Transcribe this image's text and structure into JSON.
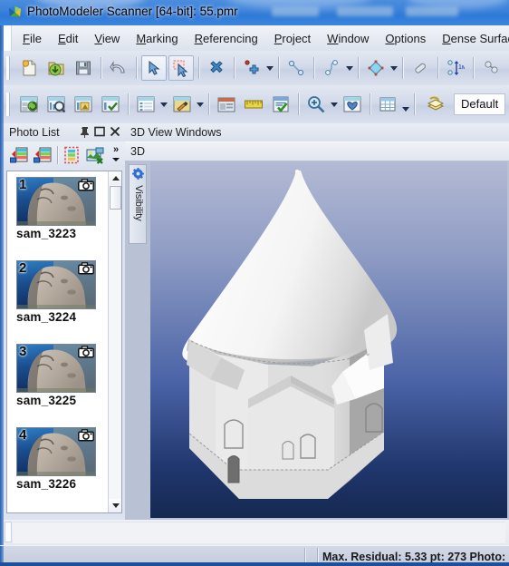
{
  "window": {
    "title": "PhotoModeler Scanner [64-bit]: 55.pmr",
    "app_icon": "photomodeler-logo-icon"
  },
  "menu": {
    "items": [
      {
        "label": "File",
        "mnemonic": "F"
      },
      {
        "label": "Edit",
        "mnemonic": "E"
      },
      {
        "label": "View",
        "mnemonic": "V"
      },
      {
        "label": "Marking",
        "mnemonic": "M"
      },
      {
        "label": "Referencing",
        "mnemonic": "R"
      },
      {
        "label": "Project",
        "mnemonic": "P"
      },
      {
        "label": "Window",
        "mnemonic": "W"
      },
      {
        "label": "Options",
        "mnemonic": "O"
      },
      {
        "label": "Dense Surface",
        "mnemonic": "D"
      }
    ]
  },
  "toolbar_row1": {
    "buttons": [
      {
        "name": "new-project-icon",
        "tip": "New Project"
      },
      {
        "name": "open-project-icon",
        "tip": "Open Project"
      },
      {
        "name": "save-project-icon",
        "tip": "Save Project"
      },
      {
        "name": "undo-icon",
        "tip": "Undo"
      },
      {
        "name": "select-pointer-icon",
        "tip": "Select",
        "state": "active"
      },
      {
        "name": "select-by-area-icon",
        "tip": "Select By Area",
        "state": "active"
      },
      {
        "name": "delete-item-icon",
        "tip": "Delete Item"
      },
      {
        "name": "mark-points-icon",
        "tip": "Mark Points"
      },
      {
        "name": "mark-line-icon",
        "tip": "Mark Lines"
      },
      {
        "name": "mark-curve-icon",
        "tip": "Mark Curves"
      },
      {
        "name": "mark-surface-icon",
        "tip": "Mark Surfaces"
      },
      {
        "name": "mark-cylinder-icon",
        "tip": "Mark Cylinder"
      },
      {
        "name": "scale-rotate-icon",
        "tip": "Scale / Rotate"
      },
      {
        "name": "reference-points-icon",
        "tip": "Reference Mode"
      }
    ]
  },
  "toolbar_row2": {
    "buttons": [
      {
        "name": "process-project-icon",
        "tip": "Process"
      },
      {
        "name": "project-status-icon",
        "tip": "Project Status Report"
      },
      {
        "name": "camera-info-icon",
        "tip": "Camera Information"
      },
      {
        "name": "quality-check-icon",
        "tip": "Quality Check"
      },
      {
        "name": "open-table-icon",
        "tip": "Open Table"
      },
      {
        "name": "materials-icon",
        "tip": "Materials / Texture"
      },
      {
        "name": "photo-window-icon",
        "tip": "Open Photo"
      },
      {
        "name": "measure-ruler-icon",
        "tip": "Measure"
      },
      {
        "name": "audit-icon",
        "tip": "Audit"
      },
      {
        "name": "zoom-icon",
        "tip": "Zoom"
      },
      {
        "name": "dense-surface-icon",
        "tip": "Dense Surface"
      },
      {
        "name": "table-grid-icon",
        "tip": "Tables"
      },
      {
        "name": "layers-icon",
        "tip": "Layers"
      }
    ],
    "layer_value": "Default"
  },
  "photo_list": {
    "title": "Photo List",
    "header_buttons": [
      {
        "name": "pin-icon",
        "tip": "Auto Hide"
      },
      {
        "name": "maximize-icon",
        "tip": "Maximize"
      },
      {
        "name": "close-icon",
        "tip": "Close"
      }
    ],
    "toolbar_buttons": [
      {
        "name": "add-photo-icon",
        "tip": "Add Photo"
      },
      {
        "name": "add-photos-icon",
        "tip": "Add Multiple Photos"
      },
      {
        "name": "select-all-photos-icon",
        "tip": "Select All"
      },
      {
        "name": "remove-photo-icon",
        "tip": "Remove Photo"
      }
    ],
    "overflow_label": "»",
    "items": [
      {
        "index": "1",
        "label": "sam_3223"
      },
      {
        "index": "2",
        "label": "sam_3224"
      },
      {
        "index": "3",
        "label": "sam_3225"
      },
      {
        "index": "4",
        "label": "sam_3226"
      }
    ],
    "scrollbar": {
      "name": "photo-list-scrollbar"
    }
  },
  "view_panel": {
    "title": "3D View Windows",
    "tab_label": "3D",
    "visibility_tab": {
      "label": "Visibility",
      "icon": "gear-icon"
    },
    "model": {
      "name": "3d-church-dome-model",
      "description": "Shaded 3D mesh of an octagonal domed church"
    }
  },
  "status_bar": {
    "max_residual_label": "Max. Residual: 5.33 pt: 273 Photo:"
  },
  "colors": {
    "title_blue": "#3c82db",
    "toolbar_bg": "#d3daea",
    "panel_bg": "#dde3ee",
    "viewport_top": "#b3bad4",
    "viewport_bottom": "#152851",
    "accent_edge": "#2a5faa"
  }
}
